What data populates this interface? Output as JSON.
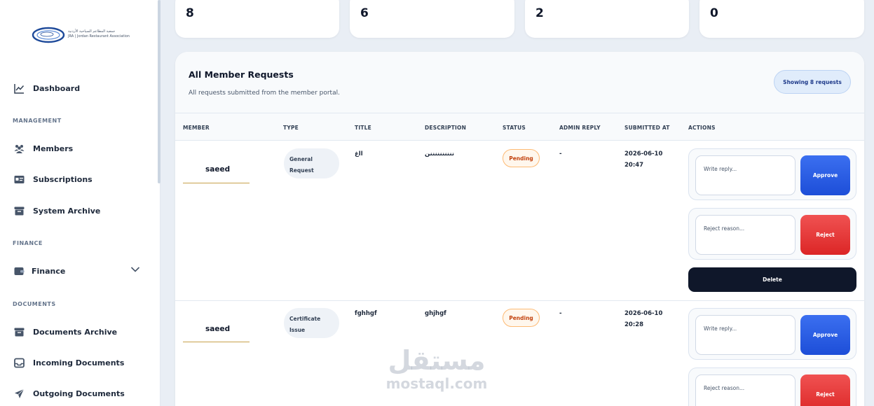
{
  "sidebar": {
    "logo_text_line1": "جمعية المطاعم السياحية الأردنية",
    "logo_text_line2": "JRA | Jordan Restaurant Association",
    "dashboard": "Dashboard",
    "section_management": "MANAGEMENT",
    "members": "Members",
    "subscriptions": "Subscriptions",
    "system_archive": "System Archive",
    "section_finance": "FINANCE",
    "finance": "Finance",
    "section_documents": "DOCUMENTS",
    "documents_archive": "Documents Archive",
    "incoming_documents": "Incoming Documents",
    "outgoing_documents": "Outgoing Documents"
  },
  "stats": [
    "8",
    "6",
    "2",
    "0"
  ],
  "card": {
    "title": "All Member Requests",
    "subtitle": "All requests submitted from the member portal.",
    "showing": "Showing 8 requests"
  },
  "columns": {
    "member": "MEMBER",
    "type": "TYPE",
    "title": "TITLE",
    "description": "DESCRIPTION",
    "status": "STATUS",
    "admin_reply": "ADMIN REPLY",
    "submitted_at": "SUBMITTED AT",
    "actions": "ACTIONS"
  },
  "rows": [
    {
      "member": "saeed",
      "type_line1": "General",
      "type_line2": "Request",
      "title": "ااغ",
      "description": "ننننننننننن",
      "status": "Pending",
      "admin_reply": "-",
      "date": "2026-06-10",
      "time": "20:47",
      "reply_placeholder": "Write reply...",
      "reject_placeholder": "Reject reason...",
      "approve_label": "Approve",
      "reject_label": "Reject",
      "delete_label": "Delete"
    },
    {
      "member": "saeed",
      "type_line1": "Certificate",
      "type_line2": "Issue",
      "title": "fghhgf",
      "description": "ghjhgf",
      "status": "Pending",
      "admin_reply": "-",
      "date": "2026-06-10",
      "time": "20:28",
      "reply_placeholder": "Write reply...",
      "reject_placeholder": "Reject reason...",
      "approve_label": "Approve",
      "reject_label": "Reject"
    }
  ],
  "watermark": {
    "arabic": "مستقل",
    "latin": "mostaql.com"
  }
}
